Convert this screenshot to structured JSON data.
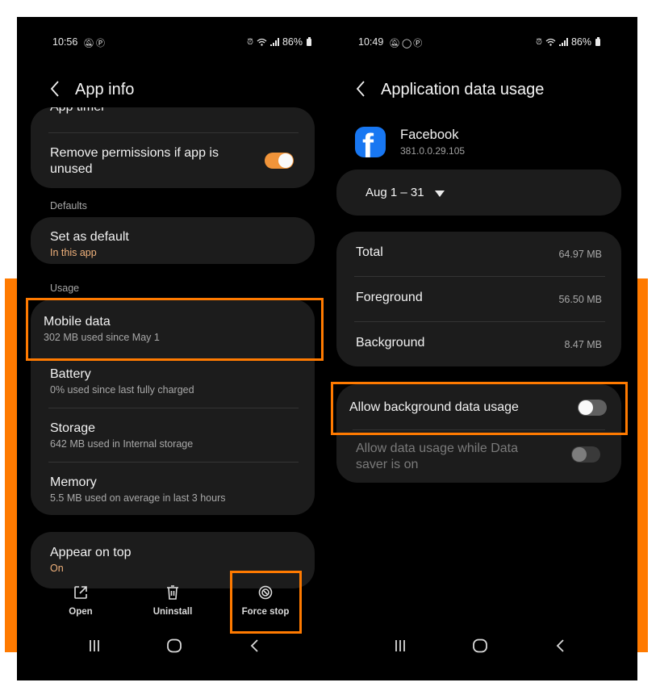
{
  "colors": {
    "accent_highlight": "#ff7a00",
    "toggle_on": "#f0943a",
    "subtext_orange": "#f1b27c",
    "card_bg": "#1c1c1c",
    "facebook_blue": "#1877f2"
  },
  "left_screen": {
    "status_bar": {
      "time": "10:56",
      "left_icons": [
        "mute-icon",
        "pinterest-icon"
      ],
      "right_icons": [
        "alarm-icon",
        "wifi-icon",
        "signal-icon"
      ],
      "battery": "86%"
    },
    "header": {
      "back_icon": "chevron-left-icon",
      "title": "App info"
    },
    "partial_item": "App timer",
    "remove_permissions": {
      "label": "Remove permissions if app is unused",
      "toggle": "on"
    },
    "sections": {
      "defaults": "Defaults",
      "usage": "Usage"
    },
    "set_as_default": {
      "title": "Set as default",
      "subtitle": "In this app"
    },
    "usage_items": [
      {
        "title": "Mobile data",
        "subtitle": "302 MB used since May 1"
      },
      {
        "title": "Battery",
        "subtitle": "0% used since last fully charged"
      },
      {
        "title": "Storage",
        "subtitle": "642 MB used in Internal storage"
      },
      {
        "title": "Memory",
        "subtitle": "5.5 MB used on average in last 3 hours"
      }
    ],
    "appear_on_top": {
      "title": "Appear on top",
      "subtitle": "On"
    },
    "actions": [
      {
        "label": "Open",
        "icon": "open-external-icon"
      },
      {
        "label": "Uninstall",
        "icon": "trash-icon"
      },
      {
        "label": "Force stop",
        "icon": "force-stop-icon"
      }
    ],
    "nav": [
      "recents-icon",
      "home-icon",
      "back-icon"
    ]
  },
  "right_screen": {
    "status_bar": {
      "time": "10:49",
      "left_icons": [
        "mute-icon",
        "whatsapp-icon",
        "pinterest-icon"
      ],
      "right_icons": [
        "alarm-icon",
        "wifi-icon",
        "signal-icon"
      ],
      "battery": "86%"
    },
    "header": {
      "back_icon": "chevron-left-icon",
      "title": "Application data usage"
    },
    "app": {
      "name": "Facebook",
      "version": "381.0.0.29.105",
      "icon": "facebook-icon",
      "icon_glyph": "f"
    },
    "period": {
      "value": "Aug 1 – 31"
    },
    "usage": [
      {
        "label": "Total",
        "value": "64.97 MB"
      },
      {
        "label": "Foreground",
        "value": "56.50 MB"
      },
      {
        "label": "Background",
        "value": "8.47 MB"
      }
    ],
    "background_data": {
      "label": "Allow background data usage",
      "toggle": "off"
    },
    "data_saver": {
      "label_line1": "Allow data usage while Data",
      "label_line2": "saver is on",
      "toggle": "off-disabled"
    },
    "nav": [
      "recents-icon",
      "home-icon",
      "back-icon"
    ]
  }
}
